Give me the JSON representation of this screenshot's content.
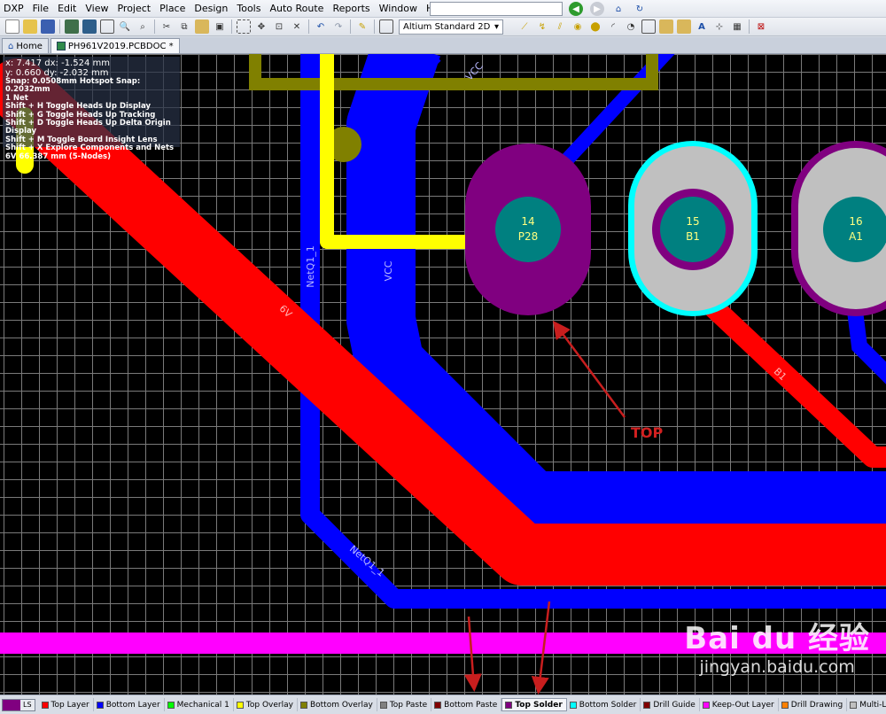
{
  "menu": [
    "DXP",
    "File",
    "Edit",
    "View",
    "Project",
    "Place",
    "Design",
    "Tools",
    "Auto Route",
    "Reports",
    "Window",
    "Help"
  ],
  "toolbar": {
    "view_mode": "Altium Standard 2D"
  },
  "tabs": [
    {
      "label": "Home",
      "icon": "home-icon"
    },
    {
      "label": "PH961V2019.PCBDOC *",
      "icon": "pcb-doc-icon"
    }
  ],
  "headsup": {
    "line1": "x:  7.417   dx: -1.524 mm",
    "line2": "y:  0.660   dy: -2.032 mm",
    "snap": "Snap: 0.0508mm Hotspot Snap: 0.2032mm",
    "nets": "1 Net",
    "shortcuts": [
      "Shift + H   Toggle Heads Up Display",
      "Shift + G   Toggle Heads Up Tracking",
      "Shift + D   Toggle Heads Up Delta Origin Display",
      "Shift + M   Toggle Board Insight Lens",
      "Shift + X   Explore Components and Nets"
    ],
    "net_info": "6V   66.387 mm  (5-Nodes)"
  },
  "pcb": {
    "net_labels": {
      "vcc_top": "VCC",
      "vcc_mid": "VCC",
      "netq1_vertical": "NetQ1_1",
      "netq1_bottom": "NetQ1_1",
      "net_6v": "6V",
      "net_b1": "B1"
    },
    "pads": [
      {
        "num": "14",
        "name": "P28"
      },
      {
        "num": "15",
        "name": "B1"
      },
      {
        "num": "16",
        "name": "A1"
      }
    ],
    "annotation": "TOP",
    "colors": {
      "top_layer": "#ff0000",
      "bottom_layer": "#0000ff",
      "top_overlay": "#ffff00",
      "bottom_overlay": "#808000",
      "top_solder": "#800080",
      "bottom_solder": "#00ffff",
      "keepout": "#ff00ff",
      "multilayer": "#c0c0c0",
      "pad_center": "#008080"
    }
  },
  "layer_tabs": {
    "ls_label": "LS",
    "items": [
      {
        "label": "Top Layer",
        "color": "#ff0000"
      },
      {
        "label": "Bottom Layer",
        "color": "#0000ff"
      },
      {
        "label": "Mechanical 1",
        "color": "#00ff00"
      },
      {
        "label": "Top Overlay",
        "color": "#ffff00"
      },
      {
        "label": "Bottom Overlay",
        "color": "#808000"
      },
      {
        "label": "Top Paste",
        "color": "#808080"
      },
      {
        "label": "Bottom Paste",
        "color": "#800000"
      },
      {
        "label": "Top Solder",
        "color": "#800080",
        "active": true
      },
      {
        "label": "Bottom Solder",
        "color": "#00ffff"
      },
      {
        "label": "Drill Guide",
        "color": "#800000"
      },
      {
        "label": "Keep-Out Layer",
        "color": "#ff00ff"
      },
      {
        "label": "Drill Drawing",
        "color": "#ff8000"
      },
      {
        "label": "Multi-Layer",
        "color": "#c0c0c0"
      }
    ]
  },
  "watermark": {
    "brand": "Bai du 经验",
    "site": "jingyan.baidu.com"
  }
}
